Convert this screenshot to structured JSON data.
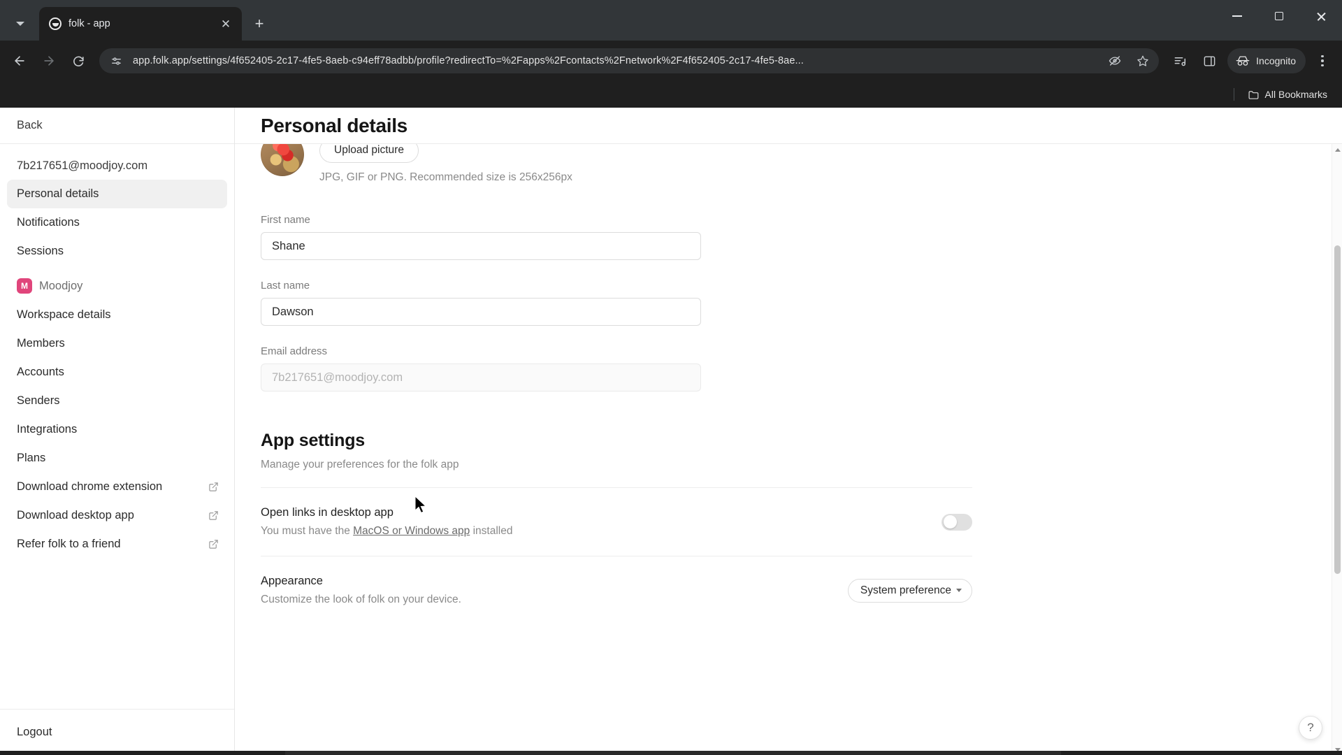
{
  "browser": {
    "tab": {
      "title": "folk - app",
      "favicon_icon": "folk-logo-icon",
      "close_icon": "close-icon"
    },
    "tab_search_icon": "chevron-down-icon",
    "new_tab_icon": "plus-icon",
    "window_controls": {
      "minimize": "minimize-icon",
      "maximize": "maximize-icon",
      "close": "close-icon"
    },
    "nav": {
      "back_icon": "arrow-left-icon",
      "forward_icon": "arrow-right-icon",
      "reload_icon": "reload-icon"
    },
    "omnibox": {
      "site_info_icon": "site-settings-icon",
      "url": "app.folk.app/settings/4f652405-2c17-4fe5-8aeb-c94eff78adbb/profile?redirectTo=%2Fapps%2Fcontacts%2Fnetwork%2F4f652405-2c17-4fe5-8ae...",
      "tracking_icon": "eye-crossed-icon",
      "bookmark_icon": "star-icon"
    },
    "toolbar_icons": {
      "reading_list": "reading-list-icon",
      "side_panel": "side-panel-icon"
    },
    "incognito": {
      "label": "Incognito",
      "icon": "incognito-icon"
    },
    "menu_icon": "kebab-menu-icon",
    "bookmarks": {
      "all_bookmarks_label": "All Bookmarks",
      "folder_icon": "folder-icon"
    }
  },
  "sidebar": {
    "back_label": "Back",
    "account_email": "7b217651@moodjoy.com",
    "personal_items": [
      {
        "label": "Personal details",
        "active": true
      },
      {
        "label": "Notifications",
        "active": false
      },
      {
        "label": "Sessions",
        "active": false
      }
    ],
    "workspace": {
      "badge": "M",
      "name": "Moodjoy",
      "badge_color": "#e0457b"
    },
    "workspace_items": [
      {
        "label": "Workspace details",
        "external": false
      },
      {
        "label": "Members",
        "external": false
      },
      {
        "label": "Accounts",
        "external": false
      },
      {
        "label": "Senders",
        "external": false
      },
      {
        "label": "Integrations",
        "external": false
      },
      {
        "label": "Plans",
        "external": false
      },
      {
        "label": "Download chrome extension",
        "external": true
      },
      {
        "label": "Download desktop app",
        "external": true
      },
      {
        "label": "Refer folk to a friend",
        "external": true
      }
    ],
    "logout_label": "Logout"
  },
  "main": {
    "page_title": "Personal details",
    "avatar": {
      "upload_button_label": "Upload picture",
      "hint": "JPG, GIF or PNG. Recommended size is 256x256px"
    },
    "fields": [
      {
        "label": "First name",
        "value": "Shane",
        "placeholder": "",
        "readonly": false
      },
      {
        "label": "Last name",
        "value": "Dawson",
        "placeholder": "",
        "readonly": false
      },
      {
        "label": "Email address",
        "value": "",
        "placeholder": "7b217651@moodjoy.com",
        "readonly": true
      }
    ],
    "app_settings": {
      "title": "App settings",
      "subtitle": "Manage your preferences for the folk app",
      "rows": [
        {
          "title": "Open links in desktop app",
          "desc_before": "You must have the ",
          "desc_link": "MacOS or Windows app",
          "desc_after": " installed",
          "control": "toggle",
          "toggle_on": false
        },
        {
          "title": "Appearance",
          "desc_before": "Customize the look of folk on your device.",
          "desc_link": "",
          "desc_after": "",
          "control": "select",
          "select_value": "System preference"
        }
      ]
    },
    "help_label": "?"
  }
}
